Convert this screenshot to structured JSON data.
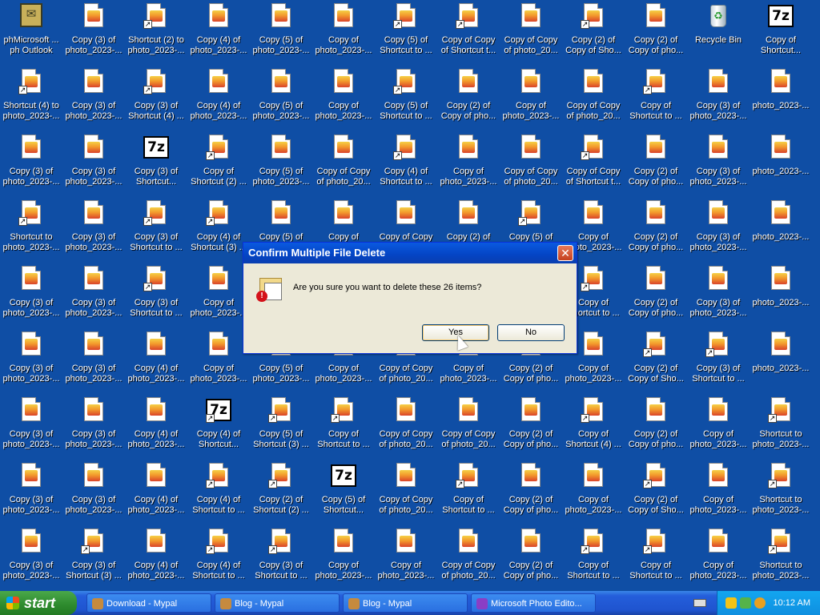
{
  "desktop": {
    "rows": [
      [
        {
          "label": "phMicrosoft ...\nph Outlook",
          "type": "outlook",
          "icon": "outlook-icon",
          "sc": false
        },
        {
          "label": "Copy (3) of\nphoto_2023-...",
          "type": "photo",
          "icon": "photo-file-icon",
          "sc": false
        },
        {
          "label": "Shortcut (2) to\nphoto_2023-...",
          "type": "photo",
          "icon": "photo-file-icon",
          "sc": true
        },
        {
          "label": "Copy (4) of\nphoto_2023-...",
          "type": "photo",
          "icon": "photo-file-icon",
          "sc": false
        },
        {
          "label": "Copy (5) of\nphoto_2023-...",
          "type": "photo",
          "icon": "photo-file-icon",
          "sc": false
        },
        {
          "label": "Copy of\nphoto_2023-...",
          "type": "photo",
          "icon": "photo-file-icon",
          "sc": false
        },
        {
          "label": "Copy (5) of\nShortcut to ...",
          "type": "photo",
          "icon": "photo-file-icon",
          "sc": true
        },
        {
          "label": "Copy of Copy\nof Shortcut t...",
          "type": "photo",
          "icon": "photo-file-icon",
          "sc": true
        },
        {
          "label": "Copy of Copy\nof photo_20...",
          "type": "photo",
          "icon": "photo-file-icon",
          "sc": false
        },
        {
          "label": "Copy (2) of\nCopy of Sho...",
          "type": "photo",
          "icon": "photo-file-icon",
          "sc": true
        },
        {
          "label": "Copy (2) of\nCopy of pho...",
          "type": "photo",
          "icon": "photo-file-icon",
          "sc": false
        },
        {
          "label": "Recycle Bin",
          "type": "recycle",
          "icon": "recycle-bin-icon",
          "sc": false
        },
        {
          "label": "Copy of\nShortcut...",
          "type": "zip",
          "icon": "7zip-archive-icon",
          "sc": false
        }
      ],
      [
        {
          "label": "Shortcut (4) to\nphoto_2023-...",
          "type": "photo",
          "icon": "photo-file-icon",
          "sc": true
        },
        {
          "label": "Copy (3) of\nphoto_2023-...",
          "type": "photo",
          "icon": "photo-file-icon",
          "sc": false
        },
        {
          "label": "Copy (3) of\nShortcut (4) ...",
          "type": "photo",
          "icon": "photo-file-icon",
          "sc": true
        },
        {
          "label": "Copy (4) of\nphoto_2023-...",
          "type": "photo",
          "icon": "photo-file-icon",
          "sc": false
        },
        {
          "label": "Copy (5) of\nphoto_2023-...",
          "type": "photo",
          "icon": "photo-file-icon",
          "sc": false
        },
        {
          "label": "Copy of\nphoto_2023-...",
          "type": "photo",
          "icon": "photo-file-icon",
          "sc": false
        },
        {
          "label": "Copy (5) of\nShortcut to ...",
          "type": "photo",
          "icon": "photo-file-icon",
          "sc": true
        },
        {
          "label": "Copy (2) of\nCopy of pho...",
          "type": "photo",
          "icon": "photo-file-icon",
          "sc": false
        },
        {
          "label": "Copy of\nphoto_2023-...",
          "type": "photo",
          "icon": "photo-file-icon",
          "sc": false
        },
        {
          "label": "Copy of Copy\nof photo_20...",
          "type": "photo",
          "icon": "photo-file-icon",
          "sc": false
        },
        {
          "label": "Copy of\nShortcut to ...",
          "type": "photo",
          "icon": "photo-file-icon",
          "sc": true
        },
        {
          "label": "Copy (3) of\nphoto_2023-...",
          "type": "photo",
          "icon": "photo-file-icon",
          "sc": false
        },
        {
          "label": "photo_2023-...",
          "type": "photo",
          "icon": "photo-file-icon",
          "sc": false
        }
      ],
      [
        {
          "label": "Copy (3) of\nphoto_2023-...",
          "type": "photo",
          "icon": "photo-file-icon",
          "sc": false
        },
        {
          "label": "Copy (3) of\nphoto_2023-...",
          "type": "photo",
          "icon": "photo-file-icon",
          "sc": false
        },
        {
          "label": "Copy (3) of\nShortcut...",
          "type": "zip",
          "icon": "7zip-archive-icon",
          "sc": false
        },
        {
          "label": "Copy of\nShortcut (2) ...",
          "type": "photo",
          "icon": "photo-file-icon",
          "sc": true
        },
        {
          "label": "Copy (5) of\nphoto_2023-...",
          "type": "photo",
          "icon": "photo-file-icon",
          "sc": false
        },
        {
          "label": "Copy of Copy\nof photo_20...",
          "type": "photo",
          "icon": "photo-file-icon",
          "sc": false
        },
        {
          "label": "Copy (4) of\nShortcut to ...",
          "type": "photo",
          "icon": "photo-file-icon",
          "sc": true
        },
        {
          "label": "Copy of\nphoto_2023-...",
          "type": "photo",
          "icon": "photo-file-icon",
          "sc": false
        },
        {
          "label": "Copy of Copy\nof photo_20...",
          "type": "photo",
          "icon": "photo-file-icon",
          "sc": false
        },
        {
          "label": "Copy of Copy\nof Shortcut t...",
          "type": "photo",
          "icon": "photo-file-icon",
          "sc": true
        },
        {
          "label": "Copy (2) of\nCopy of pho...",
          "type": "photo",
          "icon": "photo-file-icon",
          "sc": false
        },
        {
          "label": "Copy (3) of\nphoto_2023-...",
          "type": "photo",
          "icon": "photo-file-icon",
          "sc": false
        },
        {
          "label": "photo_2023-...",
          "type": "photo",
          "icon": "photo-file-icon",
          "sc": false
        }
      ],
      [
        {
          "label": "Shortcut to\nphoto_2023-...",
          "type": "photo",
          "icon": "photo-file-icon",
          "sc": true
        },
        {
          "label": "Copy (3) of\nphoto_2023-...",
          "type": "photo",
          "icon": "photo-file-icon",
          "sc": false
        },
        {
          "label": "Copy (3) of\nShortcut to ...",
          "type": "photo",
          "icon": "photo-file-icon",
          "sc": true
        },
        {
          "label": "Copy (4) of\nShortcut (3) ...",
          "type": "photo",
          "icon": "photo-file-icon",
          "sc": true
        },
        {
          "label": "Copy (5) of",
          "type": "photo",
          "icon": "photo-file-icon",
          "sc": false
        },
        {
          "label": "Copy of",
          "type": "photo",
          "icon": "photo-file-icon",
          "sc": false
        },
        {
          "label": "Copy of Copy",
          "type": "photo",
          "icon": "photo-file-icon",
          "sc": false
        },
        {
          "label": "Copy (2) of",
          "type": "photo",
          "icon": "photo-file-icon",
          "sc": false
        },
        {
          "label": "Copy (5) of",
          "type": "photo",
          "icon": "photo-file-icon",
          "sc": true
        },
        {
          "label": "Copy of\nphoto_2023-...",
          "type": "photo",
          "icon": "photo-file-icon",
          "sc": false
        },
        {
          "label": "Copy (2) of\nCopy of pho...",
          "type": "photo",
          "icon": "photo-file-icon",
          "sc": false
        },
        {
          "label": "Copy (3) of\nphoto_2023-...",
          "type": "photo",
          "icon": "photo-file-icon",
          "sc": false
        },
        {
          "label": "photo_2023-...",
          "type": "photo",
          "icon": "photo-file-icon",
          "sc": false
        }
      ],
      [
        {
          "label": "Copy (3) of\nphoto_2023-...",
          "type": "photo",
          "icon": "photo-file-icon",
          "sc": false
        },
        {
          "label": "Copy (3) of\nphoto_2023-...",
          "type": "photo",
          "icon": "photo-file-icon",
          "sc": false
        },
        {
          "label": "Copy (3) of\nShortcut to ...",
          "type": "photo",
          "icon": "photo-file-icon",
          "sc": true
        },
        {
          "label": "Copy of\nphoto_2023-...",
          "type": "photo",
          "icon": "photo-file-icon",
          "sc": false
        },
        null,
        null,
        null,
        null,
        null,
        {
          "label": "Copy of\nShortcut to ...",
          "type": "photo",
          "icon": "photo-file-icon",
          "sc": true
        },
        {
          "label": "Copy (2) of\nCopy of pho...",
          "type": "photo",
          "icon": "photo-file-icon",
          "sc": false
        },
        {
          "label": "Copy (3) of\nphoto_2023-...",
          "type": "photo",
          "icon": "photo-file-icon",
          "sc": false
        },
        {
          "label": "photo_2023-...",
          "type": "photo",
          "icon": "photo-file-icon",
          "sc": false
        }
      ],
      [
        {
          "label": "Copy (3) of\nphoto_2023-...",
          "type": "photo",
          "icon": "photo-file-icon",
          "sc": false
        },
        {
          "label": "Copy (3) of\nphoto_2023-...",
          "type": "photo",
          "icon": "photo-file-icon",
          "sc": false
        },
        {
          "label": "Copy (4) of\nphoto_2023-...",
          "type": "photo",
          "icon": "photo-file-icon",
          "sc": false
        },
        {
          "label": "Copy of\nphoto_2023-...",
          "type": "photo",
          "icon": "photo-file-icon",
          "sc": false
        },
        {
          "label": "Copy (5) of\nphoto_2023-...",
          "type": "photo",
          "icon": "photo-file-icon",
          "sc": false
        },
        {
          "label": "Copy of\nphoto_2023-...",
          "type": "photo",
          "icon": "photo-file-icon",
          "sc": false
        },
        {
          "label": "Copy of Copy\nof photo_20...",
          "type": "photo",
          "icon": "photo-file-icon",
          "sc": false
        },
        {
          "label": "Copy of\nphoto_2023-...",
          "type": "photo",
          "icon": "photo-file-icon",
          "sc": false
        },
        {
          "label": "Copy (2) of\nCopy of pho...",
          "type": "photo",
          "icon": "photo-file-icon",
          "sc": false
        },
        {
          "label": "Copy of\nphoto_2023-...",
          "type": "photo",
          "icon": "photo-file-icon",
          "sc": false
        },
        {
          "label": "Copy (2) of\nCopy of Sho...",
          "type": "photo",
          "icon": "photo-file-icon",
          "sc": true
        },
        {
          "label": "Copy (3) of\nShortcut to ...",
          "type": "photo",
          "icon": "photo-file-icon",
          "sc": true
        },
        {
          "label": "photo_2023-...",
          "type": "photo",
          "icon": "photo-file-icon",
          "sc": false
        }
      ],
      [
        {
          "label": "Copy (3) of\nphoto_2023-...",
          "type": "photo",
          "icon": "photo-file-icon",
          "sc": false
        },
        {
          "label": "Copy (3) of\nphoto_2023-...",
          "type": "photo",
          "icon": "photo-file-icon",
          "sc": false
        },
        {
          "label": "Copy (4) of\nphoto_2023-...",
          "type": "photo",
          "icon": "photo-file-icon",
          "sc": false
        },
        {
          "label": "Copy (4) of\nShortcut...",
          "type": "zip",
          "icon": "7zip-archive-icon",
          "sc": true
        },
        {
          "label": "Copy (5) of\nShortcut (3) ...",
          "type": "photo",
          "icon": "photo-file-icon",
          "sc": true
        },
        {
          "label": "Copy of\nShortcut to ...",
          "type": "photo",
          "icon": "photo-file-icon",
          "sc": true
        },
        {
          "label": "Copy of Copy\nof photo_20...",
          "type": "photo",
          "icon": "photo-file-icon",
          "sc": false
        },
        {
          "label": "Copy of Copy\nof photo_20...",
          "type": "photo",
          "icon": "photo-file-icon",
          "sc": false
        },
        {
          "label": "Copy (2) of\nCopy of pho...",
          "type": "photo",
          "icon": "photo-file-icon",
          "sc": false
        },
        {
          "label": "Copy of\nShortcut (4) ...",
          "type": "photo",
          "icon": "photo-file-icon",
          "sc": true
        },
        {
          "label": "Copy (2) of\nCopy of pho...",
          "type": "photo",
          "icon": "photo-file-icon",
          "sc": false
        },
        {
          "label": "Copy of\nphoto_2023-...",
          "type": "photo",
          "icon": "photo-file-icon",
          "sc": false
        },
        {
          "label": "Shortcut to\nphoto_2023-...",
          "type": "photo",
          "icon": "photo-file-icon",
          "sc": true
        }
      ],
      [
        {
          "label": "Copy (3) of\nphoto_2023-...",
          "type": "photo",
          "icon": "photo-file-icon",
          "sc": false
        },
        {
          "label": "Copy (3) of\nphoto_2023-...",
          "type": "photo",
          "icon": "photo-file-icon",
          "sc": false
        },
        {
          "label": "Copy (4) of\nphoto_2023-...",
          "type": "photo",
          "icon": "photo-file-icon",
          "sc": false
        },
        {
          "label": "Copy (4) of\nShortcut to ...",
          "type": "photo",
          "icon": "photo-file-icon",
          "sc": true
        },
        {
          "label": "Copy (2) of\nShortcut (2) ...",
          "type": "photo",
          "icon": "photo-file-icon",
          "sc": true
        },
        {
          "label": "Copy (5) of\nShortcut...",
          "type": "zip",
          "icon": "7zip-archive-icon",
          "sc": false
        },
        {
          "label": "Copy of Copy\nof photo_20...",
          "type": "photo",
          "icon": "photo-file-icon",
          "sc": false
        },
        {
          "label": "Copy of\nShortcut to ...",
          "type": "photo",
          "icon": "photo-file-icon",
          "sc": true
        },
        {
          "label": "Copy (2) of\nCopy of pho...",
          "type": "photo",
          "icon": "photo-file-icon",
          "sc": false
        },
        {
          "label": "Copy of\nphoto_2023-...",
          "type": "photo",
          "icon": "photo-file-icon",
          "sc": false
        },
        {
          "label": "Copy (2) of\nCopy of Sho...",
          "type": "photo",
          "icon": "photo-file-icon",
          "sc": true
        },
        {
          "label": "Copy of\nphoto_2023-...",
          "type": "photo",
          "icon": "photo-file-icon",
          "sc": false
        },
        {
          "label": "Shortcut to\nphoto_2023-...",
          "type": "photo",
          "icon": "photo-file-icon",
          "sc": true
        }
      ],
      [
        {
          "label": "Copy (3) of\nphoto_2023-...",
          "type": "photo",
          "icon": "photo-file-icon",
          "sc": false
        },
        {
          "label": "Copy (3) of\nShortcut (3) ...",
          "type": "photo",
          "icon": "photo-file-icon",
          "sc": true
        },
        {
          "label": "Copy (4) of\nphoto_2023-...",
          "type": "photo",
          "icon": "photo-file-icon",
          "sc": false
        },
        {
          "label": "Copy (4) of\nShortcut to ...",
          "type": "photo",
          "icon": "photo-file-icon",
          "sc": true
        },
        {
          "label": "Copy (3) of\nShortcut to ...",
          "type": "photo",
          "icon": "photo-file-icon",
          "sc": true
        },
        {
          "label": "Copy of\nphoto_2023-...",
          "type": "photo",
          "icon": "photo-file-icon",
          "sc": false
        },
        {
          "label": "Copy of\nphoto_2023-...",
          "type": "photo",
          "icon": "photo-file-icon",
          "sc": false
        },
        {
          "label": "Copy of Copy\nof photo_20...",
          "type": "photo",
          "icon": "photo-file-icon",
          "sc": false
        },
        {
          "label": "Copy (2) of\nCopy of pho...",
          "type": "photo",
          "icon": "photo-file-icon",
          "sc": false
        },
        {
          "label": "Copy of\nShortcut to ...",
          "type": "photo",
          "icon": "photo-file-icon",
          "sc": true
        },
        {
          "label": "Copy of\nShortcut to ...",
          "type": "photo",
          "icon": "photo-file-icon",
          "sc": true
        },
        {
          "label": "Copy of\nphoto_2023-...",
          "type": "photo",
          "icon": "photo-file-icon",
          "sc": false
        },
        {
          "label": "Shortcut to\nphoto_2023-...",
          "type": "photo",
          "icon": "photo-file-icon",
          "sc": true
        }
      ]
    ]
  },
  "dialog": {
    "title": "Confirm Multiple File Delete",
    "close_glyph": "✕",
    "message": "Are you sure you want to delete these 26 items?",
    "yes_label": "Yes",
    "no_label": "No"
  },
  "taskbar": {
    "start_label": "start",
    "tasks": [
      {
        "label": "Download - Mypal"
      },
      {
        "label": "Blog - Mypal"
      },
      {
        "label": "Blog - Mypal"
      },
      {
        "label": "Microsoft Photo Edito..."
      }
    ],
    "clock": "10:12 AM"
  },
  "colors": {
    "desktop_bg": "#0f4ea5",
    "taskbar_blue": "#245edb",
    "start_green": "#2d8a2d",
    "dialog_title_blue": "#0444c4"
  }
}
